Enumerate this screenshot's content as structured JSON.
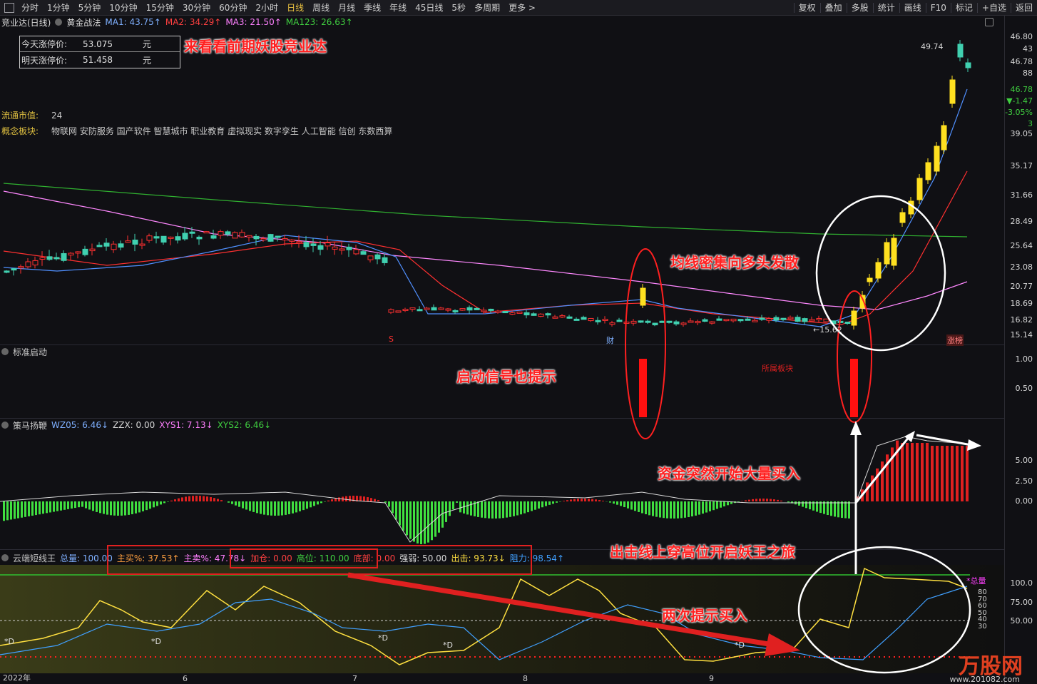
{
  "toolbar": {
    "periods": [
      "分时",
      "1分钟",
      "5分钟",
      "10分钟",
      "15分钟",
      "30分钟",
      "60分钟",
      "2小时",
      "日线",
      "周线",
      "月线",
      "季线",
      "年线",
      "45日线",
      "5秒",
      "多周期",
      "更多 >"
    ],
    "active_period": "日线",
    "right_items": [
      "复权",
      "叠加",
      "多股",
      "统计",
      "画线",
      "F10",
      "标记",
      "+自选",
      "返回"
    ]
  },
  "main_panel": {
    "stock_name": "竞业达(日线)",
    "indicator": "黄金战法",
    "ma": [
      {
        "label": "MA1: 43.75↑",
        "color": "#7fb0ff"
      },
      {
        "label": "MA2: 34.29↑",
        "color": "#ff4040"
      },
      {
        "label": "MA3: 21.50↑",
        "color": "#ff80ff"
      },
      {
        "label": "MA123: 26.63↑",
        "color": "#40d040"
      }
    ],
    "info_box": [
      {
        "label": "今天涨停价:",
        "value": "53.075",
        "unit": "元"
      },
      {
        "label": "明天涨停价:",
        "value": "51.458",
        "unit": "元"
      }
    ],
    "float_cap_label": "流通市值:",
    "float_cap_value": "24",
    "concept_label": "概念板块:",
    "concept_value": "物联网 安防服务 国产软件 智慧城市 职业教育 虚拟现实 数字孪生 人工智能 信创 东数西算",
    "high_label": "49.74",
    "low_label": "←15.62",
    "markers": {
      "s": "S",
      "cai": "财",
      "zhangbang": "涨榜"
    },
    "y_labels": [
      "46.80",
      "43",
      "46.78",
      "88",
      "46.78",
      "▼-1.47",
      "-3.05%",
      "3",
      "39.05",
      "35.17",
      "31.66",
      "28.49",
      "25.64",
      "23.08",
      "20.77",
      "18.69",
      "16.82",
      "15.14"
    ]
  },
  "panel2": {
    "title": "标准启动",
    "sector_label": "所属板块",
    "y_labels": [
      "1.00",
      "0.50"
    ]
  },
  "panel3": {
    "title": "策马扬鞭",
    "items": [
      {
        "label": "WZ05: 6.46↓",
        "color": "#7fb0ff"
      },
      {
        "label": "ZZX: 0.00",
        "color": "#d8d8d8"
      },
      {
        "label": "XYS1: 7.13↓",
        "color": "#ff80ff"
      },
      {
        "label": "XYS2: 6.46↓",
        "color": "#40d040"
      }
    ],
    "y_labels": [
      "5.00",
      "2.50",
      "0.00"
    ]
  },
  "panel4": {
    "title": "云端短线王",
    "items": [
      {
        "label": "总量: 100.00",
        "color": "#7fb0ff"
      },
      {
        "label": "主买%: 37.53↑",
        "color": "#ffa040"
      },
      {
        "label": "主卖%: 47.78↓",
        "color": "#ff80ff"
      },
      {
        "label": "加仓: 0.00",
        "color": "#ff4040"
      },
      {
        "label": "高位: 110.00",
        "color": "#40d040"
      },
      {
        "label": "底部: 0.00",
        "color": "#ff4040"
      },
      {
        "label": "强弱: 50.00",
        "color": "#d8d8d8"
      },
      {
        "label": "出击: 93.73↓",
        "color": "#ffe040"
      },
      {
        "label": "阻力: 98.54↑",
        "color": "#40a0ff"
      }
    ],
    "total_label": "*总量",
    "y_labels": [
      "100.0",
      "75.00",
      "50.00"
    ],
    "mini_scale": [
      "80",
      "70",
      "60",
      "50",
      "40",
      "30"
    ],
    "d_marks": [
      "*D",
      "*D",
      "*D",
      "*D",
      "*D"
    ]
  },
  "x_axis": [
    "2022年",
    "6",
    "7",
    "8",
    "9"
  ],
  "annotations": {
    "a1": "来看看前期妖股竞业达",
    "a2": "均线密集向多头发散",
    "a3": "启动信号也提示",
    "a4": "资金突然开始大量买入",
    "a5": "出击线上穿高位开启妖王之旅",
    "a6": "两次提示买入"
  },
  "watermark": {
    "brand": "万股网",
    "url": "www.201082.com"
  }
}
